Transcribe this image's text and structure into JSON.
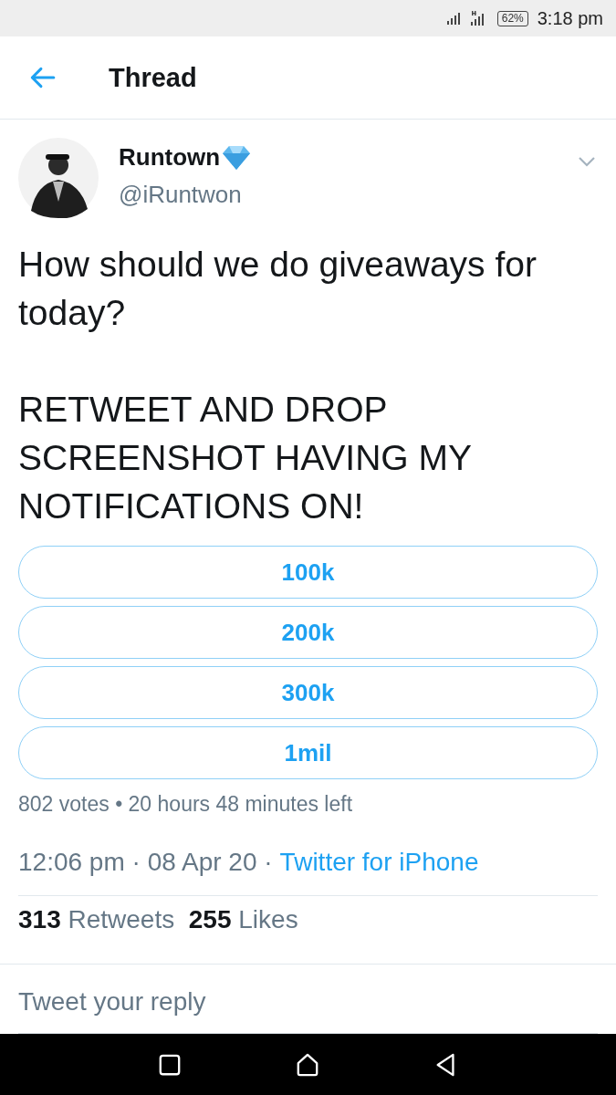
{
  "status_bar": {
    "battery": "62%",
    "time": "3:18 pm"
  },
  "header": {
    "title": "Thread"
  },
  "tweet": {
    "author": {
      "name": "Runtown",
      "handle": "@iRuntwon"
    },
    "paragraphs": [
      "How should we do giveaways for today?",
      "RETWEET AND DROP SCREENSHOT HAVING MY NOTIFICATIONS ON!"
    ],
    "poll": {
      "options": [
        {
          "label": "100k"
        },
        {
          "label": "200k"
        },
        {
          "label": "300k"
        },
        {
          "label": "1mil"
        }
      ],
      "summary": "802 votes • 20 hours 48 minutes left"
    },
    "timestamp": "12:06 pm · 08 Apr 20 ·",
    "source": "Twitter for iPhone",
    "stats": "**313** Retweets  **255** Likes"
  },
  "reply": {
    "placeholder": "Tweet your reply"
  }
}
